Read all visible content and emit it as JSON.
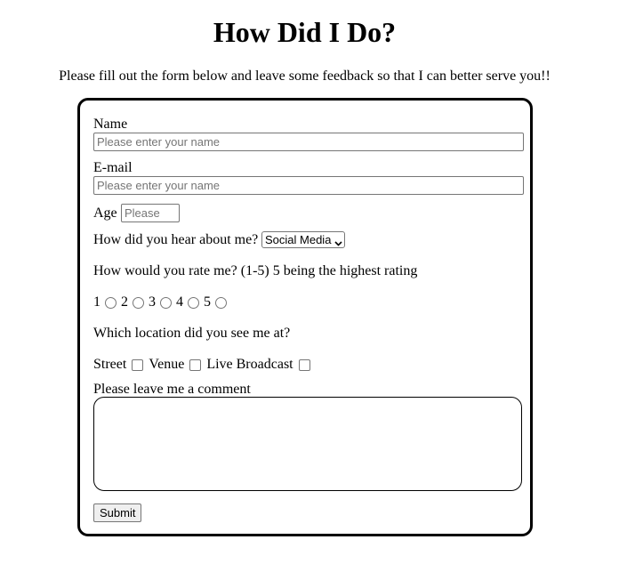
{
  "page": {
    "title": "How Did I Do?",
    "intro": "Please fill out the form below and leave some feedback so that I can better serve you!!"
  },
  "form": {
    "name_label": "Name",
    "name_placeholder": "Please enter your name",
    "email_label": "E-mail",
    "email_placeholder": "Please enter your name",
    "age_label": "Age",
    "age_placeholder": "Please",
    "source_label": "How did you hear about me?",
    "source_selected": "Social Media",
    "source_icon": "chevron-down-icon",
    "rating_label": "How would you rate me? (1-5) 5 being the highest rating",
    "rating_options": [
      "1",
      "2",
      "3",
      "4",
      "5"
    ],
    "location_label": "Which location did you see me at?",
    "location_options": [
      "Street",
      "Venue",
      "Live Broadcast"
    ],
    "comment_label": "Please leave me a comment",
    "submit_label": "Submit"
  }
}
